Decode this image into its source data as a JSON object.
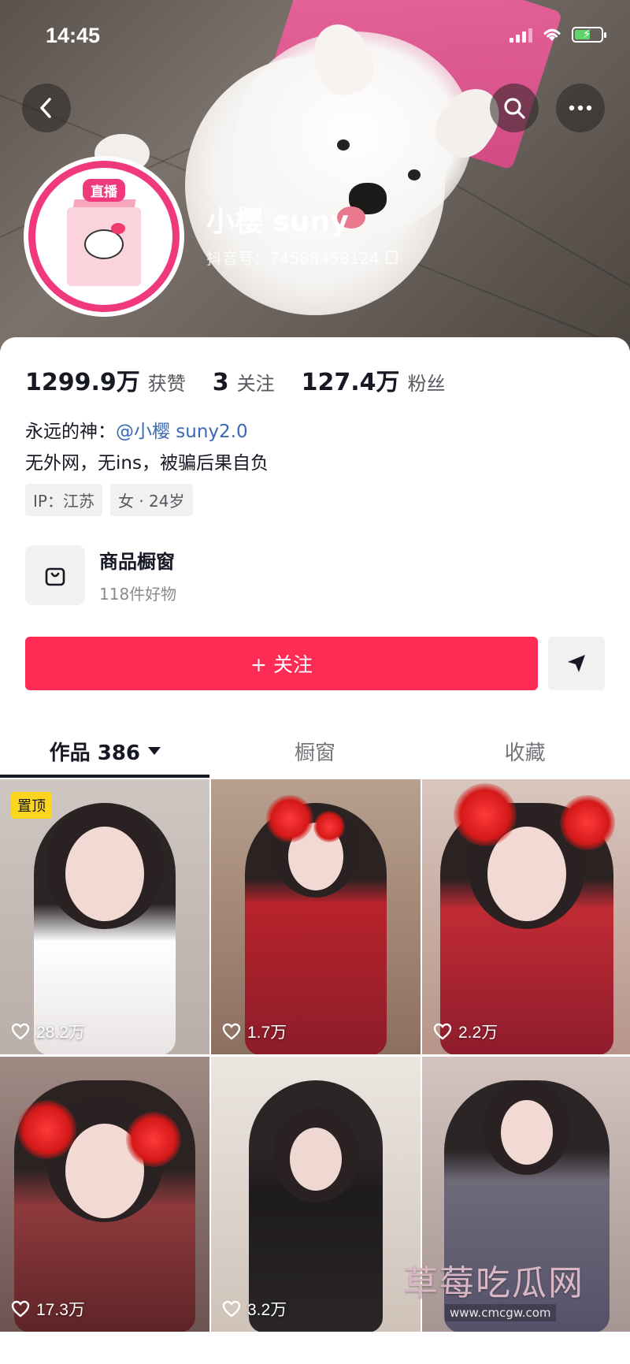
{
  "status_bar": {
    "time": "14:45"
  },
  "profile": {
    "live_badge": "直播",
    "username": "小樱 suny",
    "douyin_id": "抖音号：74588458124"
  },
  "stats": [
    {
      "value": "1299.9万",
      "label": "获赞"
    },
    {
      "value": "3",
      "label": "关注"
    },
    {
      "value": "127.4万",
      "label": "粉丝"
    }
  ],
  "bio": {
    "line1_prefix": "永远的神：",
    "line1_mention": "@小樱 suny2.0",
    "line2": "无外网，无ins，被骗后果自负"
  },
  "tags": [
    "IP：江苏",
    "女 · 24岁"
  ],
  "shop": {
    "title": "商品橱窗",
    "subtitle": "118件好物"
  },
  "actions": {
    "follow_label": "+ 关注"
  },
  "tabs": [
    {
      "label": "作品 386"
    },
    {
      "label": "橱窗"
    },
    {
      "label": "收藏"
    }
  ],
  "videos": [
    {
      "likes": "28.2万",
      "pinned_label": "置顶",
      "theme": "maid"
    },
    {
      "likes": "1.7万",
      "theme": "red-dress"
    },
    {
      "likes": "2.2万",
      "theme": "red-dress"
    },
    {
      "likes": "17.3万",
      "theme": "red-flower"
    },
    {
      "likes": "3.2万",
      "theme": "black"
    },
    {
      "likes": "",
      "theme": "grey"
    }
  ],
  "watermark": {
    "text": "草莓吃瓜网",
    "url": "www.cmcgw.com"
  },
  "colors": {
    "follow_button": "#fe2c55",
    "avatar_ring": "#f0387d",
    "mention": "#3a68b4",
    "pin_badge": "#fcd61e"
  }
}
